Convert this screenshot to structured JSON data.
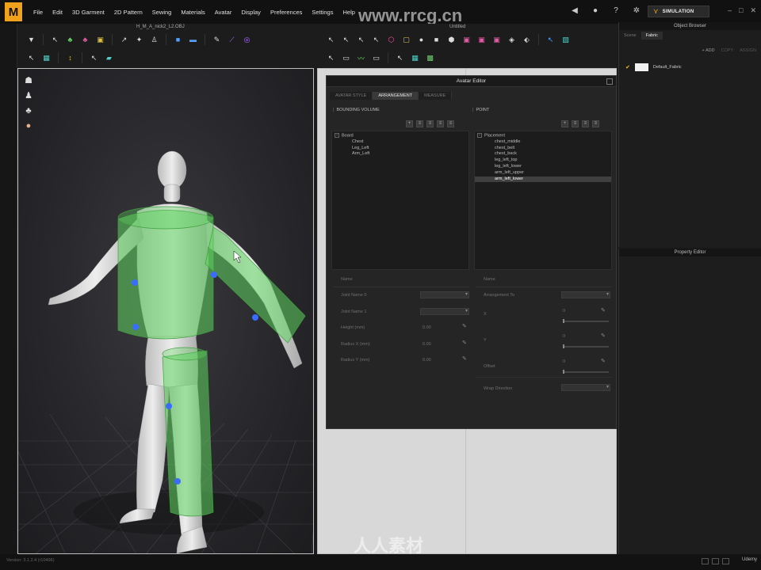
{
  "app": {
    "logo_letter": "M",
    "menu": [
      "File",
      "Edit",
      "3D Garment",
      "2D Pattern",
      "Sewing",
      "Materials",
      "Avatar",
      "Display",
      "Preferences",
      "Settings",
      "Help"
    ],
    "simulation_label": "SIMULATION"
  },
  "viewport3d": {
    "title": "H_M_A_nick2_L2.OBJ"
  },
  "pattern2d": {
    "title": "Untitled"
  },
  "avatar_editor": {
    "title": "Avatar Editor",
    "tabs": [
      "AVATAR STYLE",
      "ARRANGEMENT",
      "MEASURE"
    ],
    "active_tab": "ARRANGEMENT",
    "left": {
      "section": "BOUNDING VOLUME",
      "tree": [
        {
          "label": "Board",
          "level": 0,
          "toggle": "−"
        },
        {
          "label": "Chest",
          "level": 1
        },
        {
          "label": "Leg_Left",
          "level": 1
        },
        {
          "label": "Arm_Left",
          "level": 1
        }
      ],
      "props": [
        {
          "label": "Name",
          "value": ""
        },
        {
          "label": "Joint Name 0",
          "value": ""
        },
        {
          "label": "Joint Name 1",
          "value": ""
        },
        {
          "label": "Height (mm)",
          "value": "0.00"
        },
        {
          "label": "Radius X (mm)",
          "value": "0.00"
        },
        {
          "label": "Radius Y (mm)",
          "value": "0.00"
        }
      ]
    },
    "right": {
      "section": "POINT",
      "tree": [
        {
          "label": "Placement",
          "level": 0,
          "toggle": "−"
        },
        {
          "label": "chest_middle",
          "level": 1
        },
        {
          "label": "chest_belt",
          "level": 1
        },
        {
          "label": "chest_back",
          "level": 1
        },
        {
          "label": "leg_left_top",
          "level": 1
        },
        {
          "label": "leg_left_lower",
          "level": 1
        },
        {
          "label": "arm_left_upper",
          "level": 1
        },
        {
          "label": "arm_left_lower",
          "level": 1,
          "selected": true
        }
      ],
      "props": [
        {
          "label": "Name",
          "value": ""
        },
        {
          "label": "Arrangement To",
          "value": ""
        },
        {
          "label": "X",
          "value": "0"
        },
        {
          "label": "Y",
          "value": "0"
        },
        {
          "label": "Offset",
          "value": "0"
        },
        {
          "label": "Wrap Direction",
          "value": ""
        }
      ]
    }
  },
  "object_browser": {
    "title": "Object Browser",
    "tabs": [
      "Scene",
      "Fabric"
    ],
    "active_tab": "Fabric",
    "actions": {
      "add": "+ ADD",
      "copy": "COPY",
      "assign": "ASSIGN"
    },
    "fabric": "Default_Fabric"
  },
  "property_editor": {
    "title": "Property Editor"
  },
  "statusbar": {
    "version": "Version: 3.1.2.4  (r10496)",
    "brand": "Udemy"
  },
  "watermark": {
    "text": "www.rrcg.cn",
    "bottom": "人人素材"
  },
  "colors": {
    "accent": "#f0a21c",
    "bounding_volume": "#5fd35f",
    "point_marker": "#3a6dff"
  }
}
